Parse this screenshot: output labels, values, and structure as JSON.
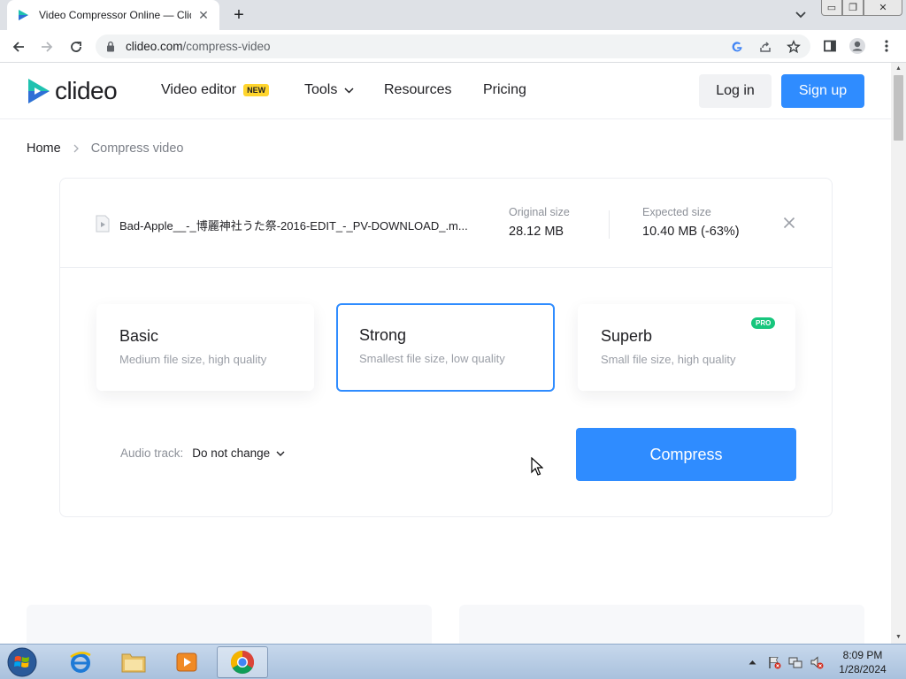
{
  "browser": {
    "tab_title": "Video Compressor Online — Clid",
    "tab_close": "✕",
    "new_tab": "+",
    "url_host": "clideo.com",
    "url_path": "/compress-video",
    "window_controls": {
      "minimize": "▭",
      "restore": "❐",
      "close": "✕"
    }
  },
  "header": {
    "logo_text": "clideo",
    "nav": [
      {
        "label": "Video editor",
        "badge": "NEW"
      },
      {
        "label": "Tools"
      },
      {
        "label": "Resources"
      },
      {
        "label": "Pricing"
      }
    ],
    "login_label": "Log in",
    "signup_label": "Sign up"
  },
  "breadcrumb": {
    "home": "Home",
    "current": "Compress video"
  },
  "file": {
    "name": "Bad-Apple__-_博麗神社うた祭-2016-EDIT_-_PV-DOWNLOAD_.m...",
    "original_size_label": "Original size",
    "original_size": "28.12 MB",
    "expected_size_label": "Expected size",
    "expected_size": "10.40 MB (-63%)"
  },
  "modes": [
    {
      "title": "Basic",
      "description": "Medium file size, high quality",
      "selected": false
    },
    {
      "title": "Strong",
      "description": "Smallest file size, low quality",
      "selected": true
    },
    {
      "title": "Superb",
      "description": "Small file size, high quality",
      "badge": "PRO",
      "selected": false
    }
  ],
  "audio": {
    "label": "Audio track:",
    "value": "Do not change"
  },
  "compress_label": "Compress",
  "taskbar": {
    "time": "8:09 PM",
    "date": "1/28/2024"
  },
  "colors": {
    "accent": "#2f8cff",
    "new_badge": "#ffd52e",
    "pro_badge": "#17c67d",
    "logo_teal": "#1fc2b0",
    "logo_blue": "#2f6fd6"
  },
  "icons": {
    "favicon": "clideo-play-icon",
    "file": "video-file-icon",
    "remove": "close-icon",
    "tools_dropdown": "chevron-down-icon",
    "audio_dropdown": "chevron-down-icon"
  }
}
